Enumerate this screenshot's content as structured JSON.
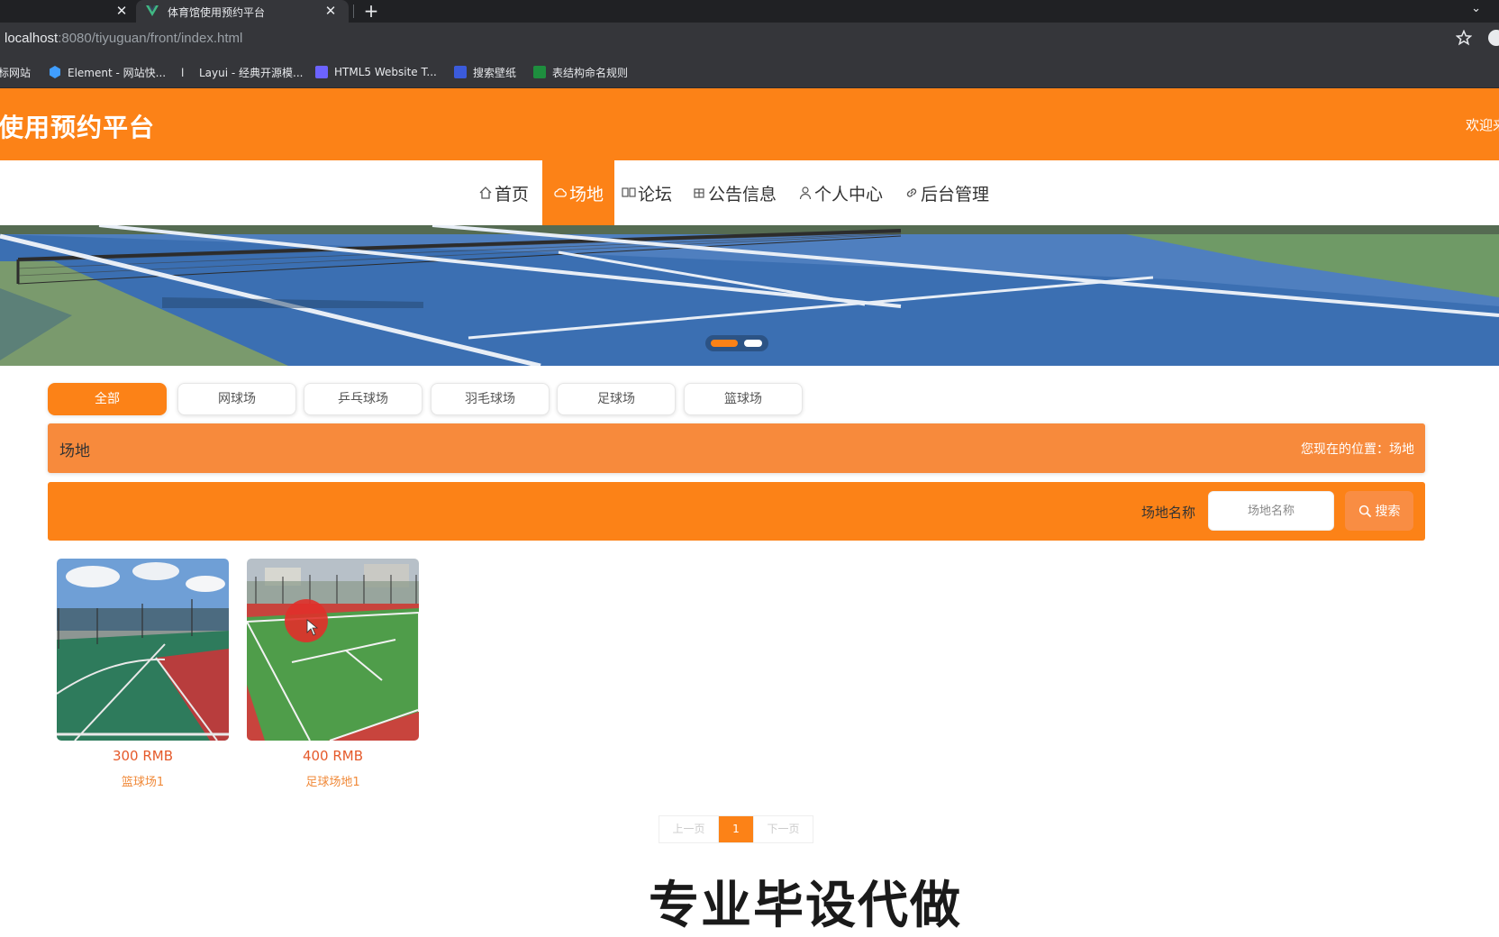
{
  "browser": {
    "tab_title": "体育馆使用预约平台",
    "url_host": "localhost",
    "url_rest": ":8080/tiyuguan/front/index.html",
    "bookmarks": [
      {
        "label": "标网站",
        "icon": "none"
      },
      {
        "label": "Element - 网站快...",
        "icon": "element-icon"
      },
      {
        "label": "Layui - 经典开源模...",
        "icon": "layui-icon"
      },
      {
        "label": "HTML5 Website T...",
        "icon": "html5-icon"
      },
      {
        "label": "搜索壁纸",
        "icon": "wallpaper-icon"
      },
      {
        "label": "表结构命名规则",
        "icon": "sheet-icon"
      }
    ]
  },
  "header": {
    "title": "使用预约平台",
    "welcome": "欢迎来"
  },
  "nav": {
    "items": [
      {
        "label": "首页",
        "icon": "home-icon"
      },
      {
        "label": "场地",
        "icon": "cloud-icon",
        "active": true
      },
      {
        "label": "论坛",
        "icon": "forum-icon"
      },
      {
        "label": "公告信息",
        "icon": "notice-icon"
      },
      {
        "label": "个人中心",
        "icon": "user-icon"
      },
      {
        "label": "后台管理",
        "icon": "link-icon"
      }
    ]
  },
  "banner": {
    "slides": 2,
    "active_slide": 1
  },
  "categories": [
    "全部",
    "网球场",
    "乒乓球场",
    "羽毛球场",
    "足球场",
    "篮球场"
  ],
  "breadcrumb": {
    "title": "场地",
    "location": "您现在的位置：场地"
  },
  "search": {
    "label": "场地名称",
    "placeholder": "场地名称",
    "button": "搜索"
  },
  "venues": [
    {
      "price": "300 RMB",
      "name": "篮球场1"
    },
    {
      "price": "400 RMB",
      "name": "足球场地1"
    }
  ],
  "pagination": {
    "prev": "上一页",
    "current": "1",
    "next": "下一页"
  },
  "watermark": "专业毕设代做",
  "colors": {
    "accent": "#fc8217",
    "price": "#e55a2b"
  }
}
